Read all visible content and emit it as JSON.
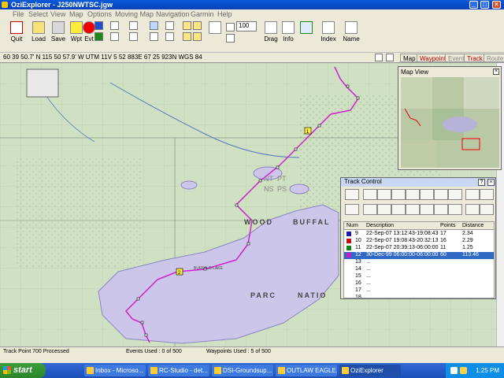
{
  "window": {
    "title": "OziExplorer - J250NWTSC.jgw",
    "buttons": {
      "minimize": "_",
      "maximize": "□",
      "close": "×"
    }
  },
  "menu": [
    "File",
    "Select",
    "View",
    "Map",
    "Options",
    "Moving Map",
    "Navigation",
    "Garmin",
    "Help"
  ],
  "toolbar": {
    "quit": "Quit",
    "load": "Load",
    "save": "Save",
    "wpt": "Wpt",
    "evt": "Evt",
    "drag": "Drag",
    "info": "Info",
    "index": "Index",
    "name": "Name",
    "zoom": "100"
  },
  "infobar": {
    "coords": "60 39 50.7' N   115 50 57.9' W   UTM 11V   5 52 883E   67 25 923N   WGS 84",
    "tabs": [
      "Map",
      "Waypoint",
      "Event",
      "Track",
      "Route"
    ]
  },
  "map": {
    "labels": [
      "WOOD",
      "BUFFAL",
      "PARC",
      "NATIO",
      "BUFFALO LAKE",
      "NT",
      "PT",
      "NS",
      "PS"
    ],
    "waypoints": [
      "1",
      "2"
    ]
  },
  "mapview": {
    "title": "Map View",
    "close": "×"
  },
  "track_control": {
    "title": "Track Control",
    "columns": [
      "Num",
      "Description",
      "Points",
      "Distance"
    ],
    "rows": [
      {
        "num": "9",
        "desc": "22-Sep-07 13:12:43-19:08:43",
        "points": "17",
        "dist": "2.34",
        "color": "#1a1aa8",
        "selected": false
      },
      {
        "num": "10",
        "desc": "22-Sep-07 19:08:43-20:32:13",
        "points": "16",
        "dist": "2.29",
        "color": "#c01010",
        "selected": false
      },
      {
        "num": "11",
        "desc": "22-Sep-07 20:39:13-06:00:00",
        "points": "11",
        "dist": "1.25",
        "color": "#108010",
        "selected": false
      },
      {
        "num": "12",
        "desc": "30-Dec-99 06:00:00-06:00:00",
        "points": "60",
        "dist": "113.46",
        "color": "#c020c0",
        "selected": true
      },
      {
        "num": "13",
        "desc": "...",
        "points": "",
        "dist": "",
        "color": "",
        "selected": false
      },
      {
        "num": "14",
        "desc": "...",
        "points": "",
        "dist": "",
        "color": "",
        "selected": false
      },
      {
        "num": "15",
        "desc": "...",
        "points": "",
        "dist": "",
        "color": "",
        "selected": false
      },
      {
        "num": "16",
        "desc": "...",
        "points": "",
        "dist": "",
        "color": "",
        "selected": false
      },
      {
        "num": "17",
        "desc": "...",
        "points": "",
        "dist": "",
        "color": "",
        "selected": false
      },
      {
        "num": "18",
        "desc": "...",
        "points": "",
        "dist": "",
        "color": "",
        "selected": false
      }
    ]
  },
  "status": {
    "left": "Track Point 700 Processed",
    "events": "Events Used : 0 of 500",
    "waypoints": "Waypoints Used : 5 of 500"
  },
  "taskbar": {
    "start": "start",
    "items": [
      "Inbox - Microso...",
      "RC-Studio - det...",
      "DSI-Groundsup...",
      "OUTLAW EAGLE...",
      "OziExplorer"
    ],
    "clock": "1:25 PM"
  }
}
